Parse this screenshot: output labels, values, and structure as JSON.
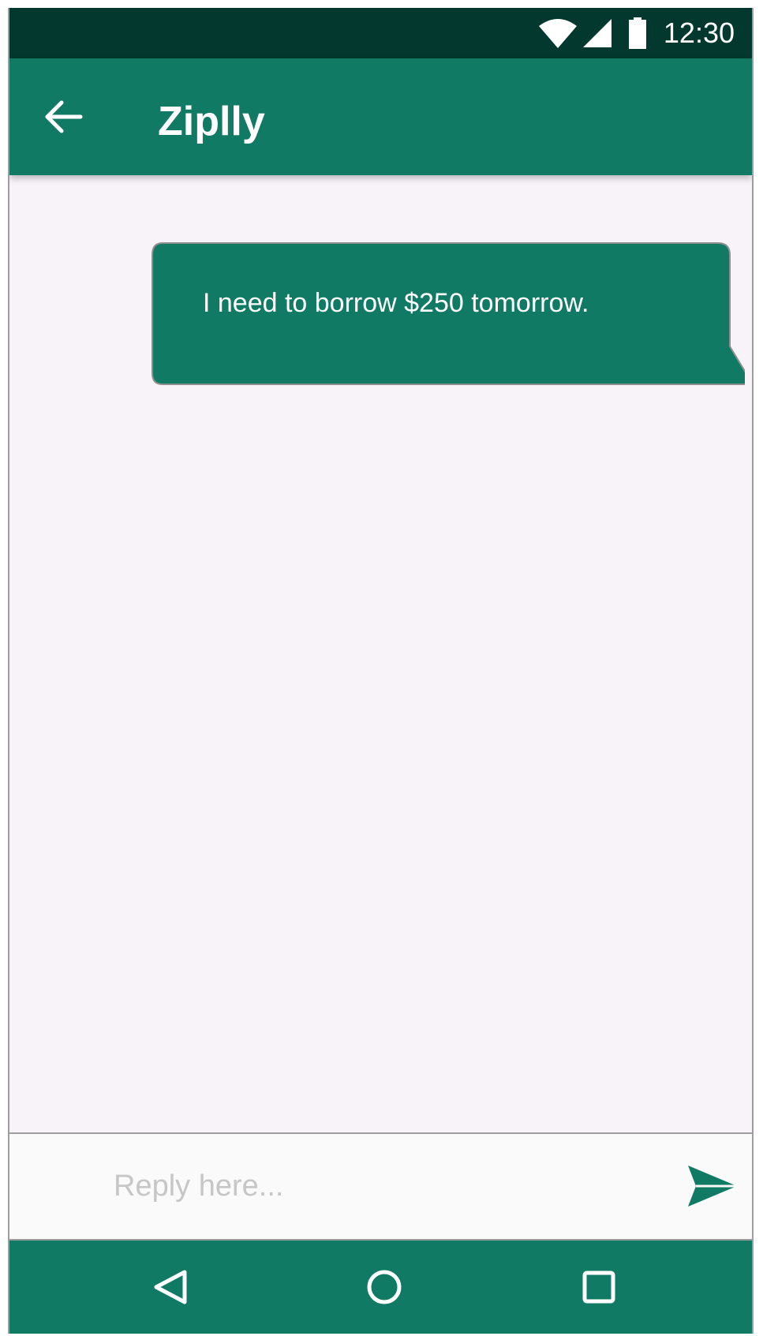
{
  "status_bar": {
    "time": "12:30",
    "icons": [
      "wifi-icon",
      "cellular-signal-icon",
      "battery-icon"
    ],
    "background_color": "#02382d"
  },
  "app_bar": {
    "title": "Ziplly",
    "back_icon": "arrow-left-icon",
    "background_color": "#117a64"
  },
  "conversation": {
    "messages": [
      {
        "direction": "outgoing",
        "text": "I need to borrow $250 tomorrow."
      }
    ],
    "bubble_color": "#117a64",
    "background_color": "#f8f3f9"
  },
  "composer": {
    "value": "",
    "placeholder": "Reply here...",
    "send_icon": "send-icon",
    "accent_color": "#117a64"
  },
  "nav_bar": {
    "buttons": [
      "back-triangle-icon",
      "home-circle-icon",
      "recents-square-icon"
    ],
    "background_color": "#117a64"
  }
}
